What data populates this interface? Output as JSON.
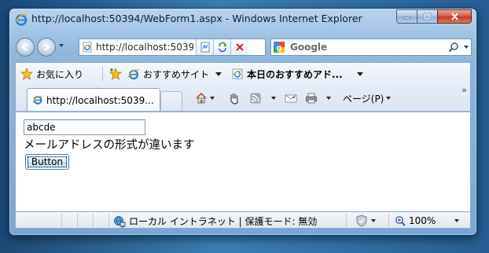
{
  "window": {
    "title": "http://localhost:50394/WebForm1.aspx - Windows Internet Explorer"
  },
  "address_bar": {
    "url": "http://localhost:50394/WebForm1.aspx"
  },
  "search": {
    "provider": "Google"
  },
  "favorites_bar": {
    "favorites_label": "お気に入り",
    "items": [
      {
        "label": "おすすめサイト"
      },
      {
        "label": "本日のおすすめアド..."
      }
    ]
  },
  "tabs": [
    {
      "label": "http://localhost:5039..."
    }
  ],
  "command_bar": {
    "page_label": "ページ(P)"
  },
  "page": {
    "input_value": "abcde",
    "validation_message": "メールアドレスの形式が違います",
    "button_label": "Button"
  },
  "status_bar": {
    "zone_text": "ローカル イントラネット | 保護モード: 無効",
    "zoom": "100%"
  },
  "colors": {
    "window_frame": "#79a7d3",
    "close_button": "#c13b24",
    "link_blue": "#1f6fc5"
  }
}
